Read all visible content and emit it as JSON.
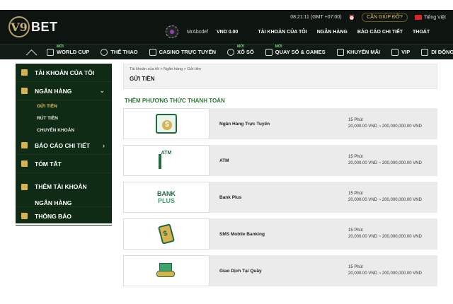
{
  "header": {
    "logo_mark": "V9",
    "logo_text": "BET",
    "time": "08:21:11",
    "timezone": "(GMT +07:00)",
    "help_label": "CẦN GIÚP ĐỠ?",
    "language": "Tiếng Việt",
    "username": "MrAbcdef",
    "balance": "VND 0.00",
    "user_menu": [
      "TÀI KHOẢN CỦA TÔI",
      "NGÂN HÀNG",
      "BÁO CÁO CHI TIẾT",
      "THOÁT"
    ]
  },
  "nav": {
    "items": [
      {
        "label": "WORLD CUP",
        "tag": "MỚI"
      },
      {
        "label": "THỂ THAO",
        "tag": ""
      },
      {
        "label": "CASINO TRỰC TUYẾN",
        "tag": ""
      },
      {
        "label": "XỔ SỐ",
        "tag": "MỚI"
      },
      {
        "label": "QUAY SỐ & GAMES",
        "tag": "MỚI"
      },
      {
        "label": "KHUYẾN MÃI",
        "tag": ""
      },
      {
        "label": "VIP",
        "tag": ""
      },
      {
        "label": "DI ĐỘNG",
        "tag": ""
      }
    ]
  },
  "sidebar": {
    "account": "TÀI KHOẢN CỦA TÔI",
    "bank": "NGÂN HÀNG",
    "sub": [
      "GỬI TIỀN",
      "RÚT TIỀN",
      "CHUYỂN KHOẢN"
    ],
    "report": "BÁO CÁO CHI TIẾT",
    "summary": "TÓM TẮT",
    "add_bank": "THÊM TÀI KHOẢN NGÂN HÀNG",
    "notice": "THÔNG BÁO"
  },
  "main": {
    "breadcrumb": "Tài khoản của tôi > Ngân hàng > Gửi tiền",
    "page_title": "GỬI TIỀN",
    "section_title": "THÊM PHƯƠNG THỨC THANH TOÁN",
    "methods": [
      {
        "name": "Ngân Hàng Trực Tuyến",
        "time": "15 Phút",
        "range": "20,000.00 VND ~ 200,000,000.00 VND",
        "icon": "online-banking-icon"
      },
      {
        "name": "ATM",
        "time": "15 Phút",
        "range": "20,000.00 VND ~ 200,000,000.00 VND",
        "icon": "atm-icon"
      },
      {
        "name": "Bank Plus",
        "time": "15 Phút",
        "range": "20,000.00 VND ~ 200,000,000.00 VND",
        "icon": "bank-plus-logo",
        "logo_l1": "BANK",
        "logo_l2": "PLUS"
      },
      {
        "name": "SMS Mobile Banking",
        "time": "15 Phút",
        "range": "20,000.00 VND ~ 200,000,000.00 VND",
        "icon": "sms-banking-icon"
      },
      {
        "name": "Giao Dịch Tại Quầy",
        "time": "15 Phút",
        "range": "20,000.00 VND ~ 200,000,000.00 VND",
        "icon": "counter-transaction-icon"
      }
    ],
    "atm_label": "ATM"
  }
}
